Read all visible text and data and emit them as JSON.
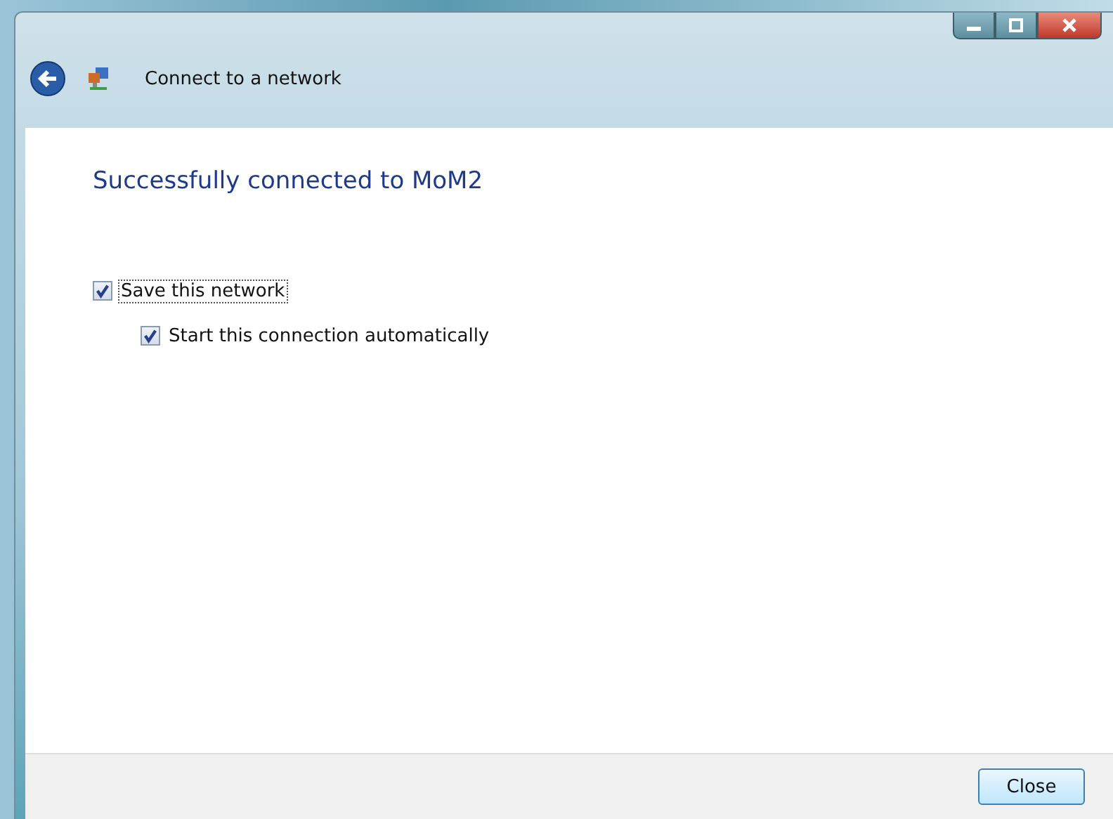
{
  "window": {
    "title": "Connect to a network"
  },
  "heading": "Successfully connected to MoM2",
  "options": [
    {
      "label": "Save this network",
      "checked": true,
      "focused": true,
      "children": [
        {
          "label": "Start this connection automatically",
          "checked": true,
          "focused": false
        }
      ]
    }
  ],
  "buttons": [
    "Close"
  ]
}
